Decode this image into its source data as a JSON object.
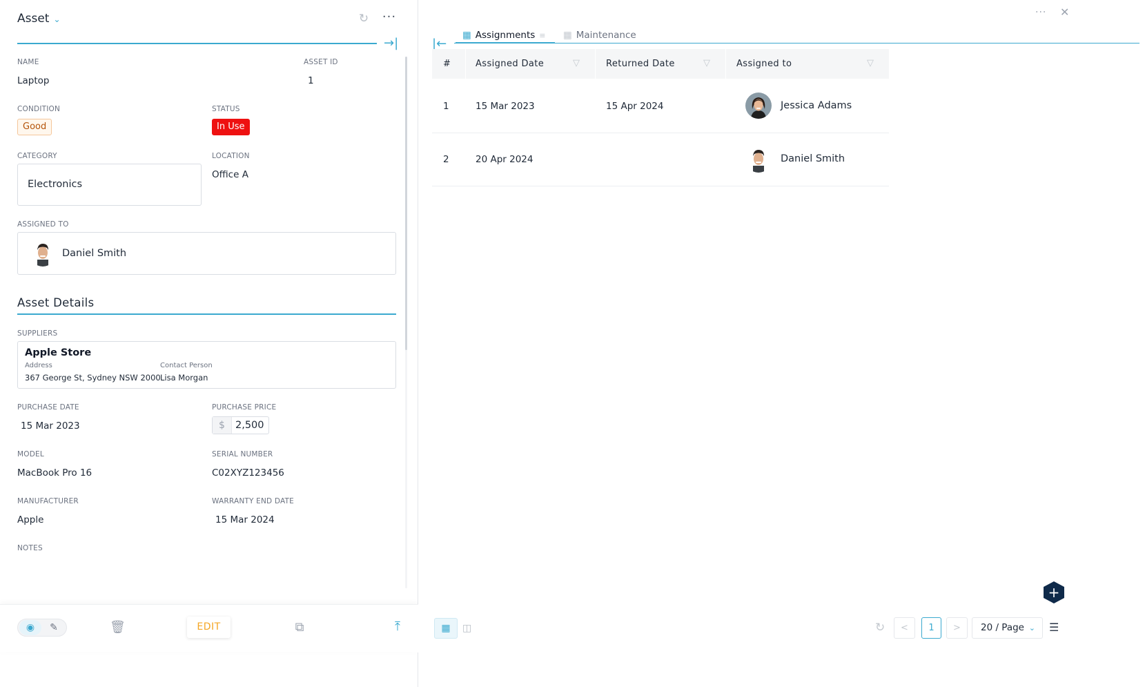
{
  "left": {
    "header": {
      "title": "Asset"
    },
    "fields": {
      "name": {
        "label": "NAME",
        "value": "Laptop"
      },
      "asset_id": {
        "label": "ASSET ID",
        "value": "1"
      },
      "condition": {
        "label": "CONDITION",
        "value": "Good"
      },
      "status": {
        "label": "STATUS",
        "value": "In Use"
      },
      "category": {
        "label": "CATEGORY",
        "value": "Electronics"
      },
      "location": {
        "label": "LOCATION",
        "value": "Office A"
      },
      "assigned_to": {
        "label": "ASSIGNED TO",
        "value": "Daniel Smith"
      }
    },
    "details": {
      "title": "Asset Details",
      "suppliers": {
        "label": "SUPPLIERS",
        "name": "Apple Store",
        "address_label": "Address",
        "address": "367 George St, Sydney NSW 2000",
        "contact_label": "Contact Person",
        "contact": "Lisa Morgan"
      },
      "purchase_date": {
        "label": "PURCHASE DATE",
        "value": "15 Mar 2023"
      },
      "purchase_price": {
        "label": "PURCHASE PRICE",
        "currency": "$",
        "value": "2,500"
      },
      "model": {
        "label": "MODEL",
        "value": "MacBook Pro 16"
      },
      "serial_number": {
        "label": "SERIAL NUMBER",
        "value": "C02XYZ123456"
      },
      "manufacturer": {
        "label": "MANUFACTURER",
        "value": "Apple"
      },
      "warranty_end_date": {
        "label": "WARRANTY END DATE",
        "value": "15 Mar 2024"
      },
      "notes": {
        "label": "NOTES"
      }
    },
    "toolbar": {
      "edit_label": "EDIT"
    }
  },
  "right": {
    "tabs": [
      {
        "label": "Assignments",
        "active": true
      },
      {
        "label": "Maintenance",
        "active": false
      }
    ],
    "table": {
      "columns": [
        "#",
        "Assigned Date",
        "Returned Date",
        "Assigned to"
      ],
      "rows": [
        {
          "num": "1",
          "assigned_date": "15 Mar 2023",
          "returned_date": "15 Apr 2024",
          "assigned_to": "Jessica Adams"
        },
        {
          "num": "2",
          "assigned_date": "20 Apr 2024",
          "returned_date": "",
          "assigned_to": "Daniel Smith"
        }
      ]
    },
    "pagination": {
      "current_page": "1",
      "page_size": "20 / Page"
    }
  },
  "colors": {
    "accent": "#3aa9cf",
    "status_red": "#ee1111",
    "good_orange": "#b45309",
    "edit_orange": "#f5a623",
    "fab_navy": "#0f2a4a"
  }
}
